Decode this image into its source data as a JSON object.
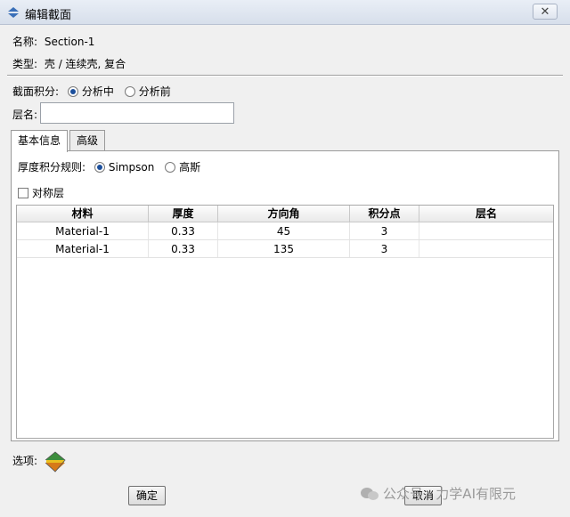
{
  "window": {
    "title": "编辑截面",
    "close_label": "✕"
  },
  "section": {
    "name_label": "名称:",
    "name_value": "Section-1",
    "type_label": "类型:",
    "type_value": "壳 / 连续壳, 复合"
  },
  "integration": {
    "label": "截面积分:",
    "options": [
      {
        "label": "分析中",
        "selected": true
      },
      {
        "label": "分析前",
        "selected": false
      }
    ]
  },
  "layer_name": {
    "label": "层名:",
    "value": ""
  },
  "tabs": [
    {
      "label": "基本信息",
      "active": true
    },
    {
      "label": "高级",
      "active": false
    }
  ],
  "thickness_rule": {
    "label": "厚度积分规则:",
    "options": [
      {
        "label": "Simpson",
        "selected": true
      },
      {
        "label": "高斯",
        "selected": false
      }
    ]
  },
  "symmetric": {
    "label": "对称层",
    "checked": false
  },
  "table": {
    "headers": [
      "材料",
      "厚度",
      "方向角",
      "积分点",
      "层名"
    ],
    "rows": [
      [
        "Material-1",
        "0.33",
        "45",
        "3",
        ""
      ],
      [
        "Material-1",
        "0.33",
        "135",
        "3",
        ""
      ]
    ]
  },
  "options_label": "选项:",
  "buttons": {
    "ok": "确定",
    "cancel": "取消"
  },
  "watermark": "公众号 · 力学AI有限元"
}
